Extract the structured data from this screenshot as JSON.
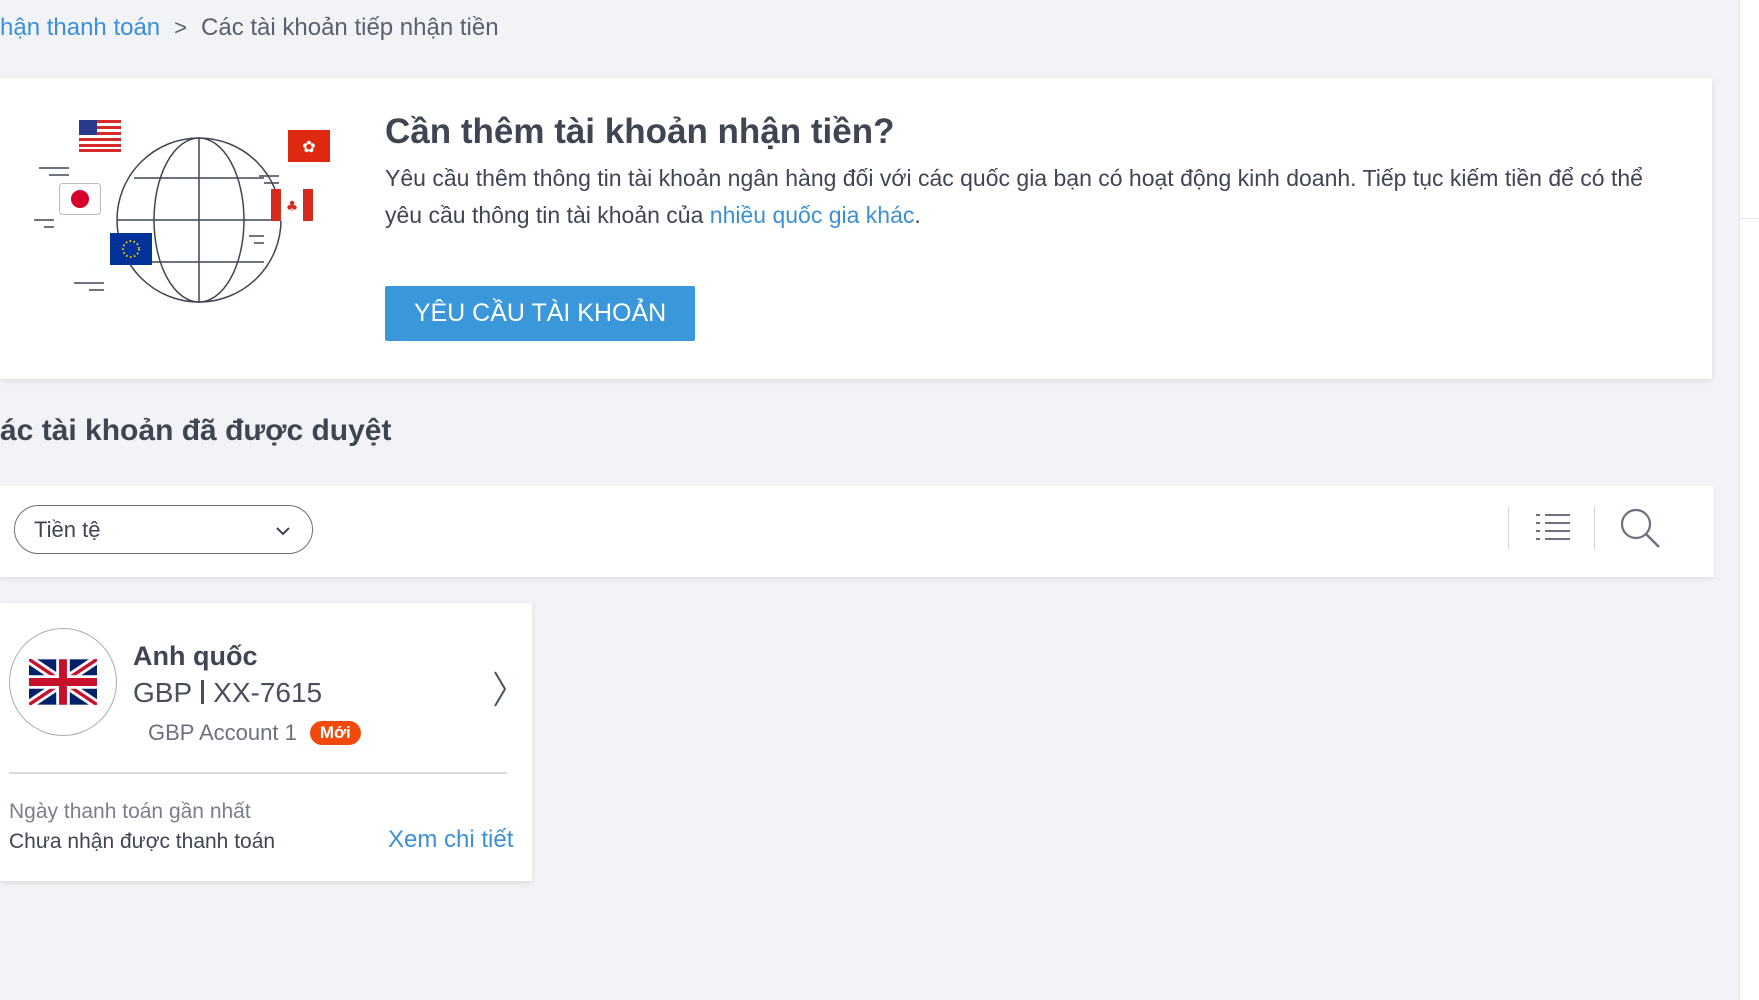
{
  "breadcrumb": {
    "parent": "hận thanh toán",
    "separator": ">",
    "current": "Các tài khoản tiếp nhận tiền"
  },
  "promo": {
    "title": "Cần thêm tài khoản nhận tiền?",
    "description_1": "Yêu cầu thêm thông tin tài khoản ngân hàng đối với các quốc gia bạn có hoạt động kinh doanh. Tiếp tục kiếm tiền để có thể yêu cầu thông tin tài khoản của",
    "description_link": "nhiều quốc gia khác",
    "description_end": ".",
    "button_label": "YÊU CẦU TÀI KHOẢN",
    "flags": [
      "us-flag-icon",
      "hong-kong-flag-icon",
      "japan-flag-icon",
      "canada-flag-icon",
      "eu-flag-icon"
    ]
  },
  "approved_section": {
    "title": "ác tài khoản đã được duyệt"
  },
  "filter_bar": {
    "currency_select": "Tiền tệ",
    "icons": [
      "list-view-icon",
      "search-icon"
    ]
  },
  "accounts": [
    {
      "country": "Anh quốc",
      "currency": "GBP",
      "number": "XX-7615",
      "name": "GBP Account 1",
      "badge": "Mới",
      "flag_icon": "uk-flag-icon",
      "last_payment_label": "Ngày thanh toán gần nhất",
      "last_payment_value": "Chưa nhận được thanh toán",
      "details_link": "Xem chi tiết"
    }
  ],
  "colors": {
    "accent": "#3a98da",
    "link": "#3a8fd6",
    "badge": "#f04b0d",
    "background": "#f2f3f6",
    "text": "#3f4553"
  }
}
